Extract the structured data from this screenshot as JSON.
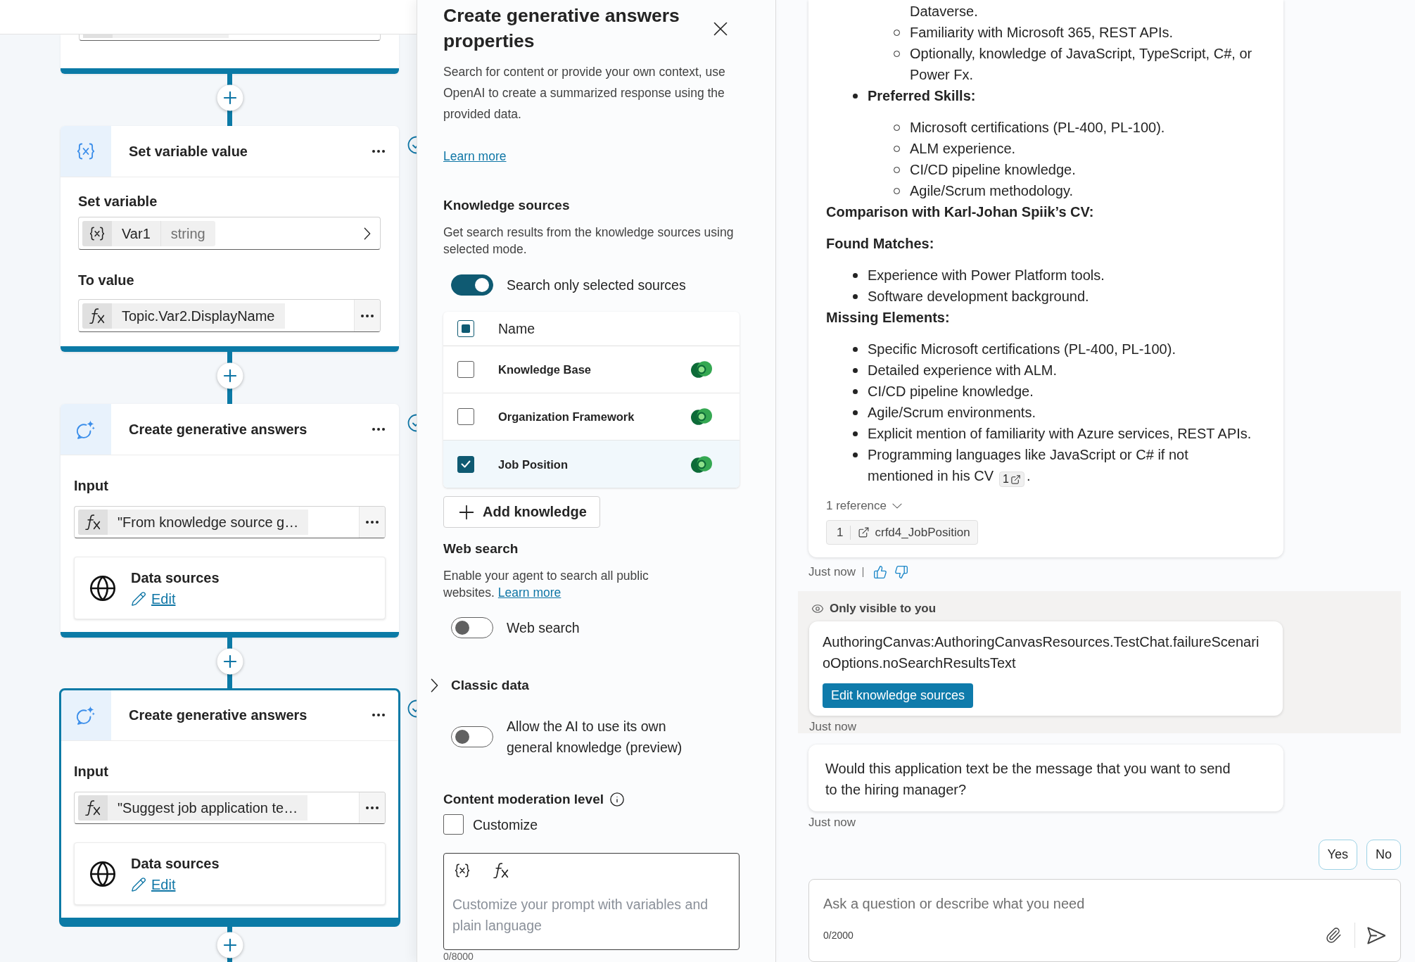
{
  "flow_canvas": {
    "nodes": [
      {
        "kind": "set_variable",
        "title": "Set variable value",
        "selected": false,
        "variable_label": "Set variable",
        "variable": "Var1",
        "variable_type": "string",
        "value_label": "To value",
        "value": "Topic.Var2.DisplayName"
      },
      {
        "kind": "generative_answers",
        "title": "Create generative answers",
        "selected": false,
        "input_label": "Input",
        "input": "\"From knowledge source g…",
        "data_sources_label": "Data sources",
        "edit_link": "Edit"
      },
      {
        "kind": "generative_answers",
        "title": "Create generative answers",
        "selected": true,
        "input_label": "Input",
        "input": "\"Suggest job application te…",
        "data_sources_label": "Data sources",
        "edit_link": "Edit"
      }
    ]
  },
  "properties_panel": {
    "title": "Create generative answers properties",
    "description": "Search for content or provide your own context, use OpenAI to create a summarized response using the provided data.",
    "learn_more": "Learn more",
    "knowledge_sources": {
      "heading": "Knowledge sources",
      "description": "Get search results from the knowledge sources using selected mode.",
      "toggle": {
        "label": "Search only selected sources",
        "on": true
      },
      "select_all": {
        "label": "Name",
        "checked": false,
        "indeterminate": true
      },
      "sources": [
        {
          "name": "Knowledge Base",
          "checked": false
        },
        {
          "name": "Organization Framework",
          "checked": false
        },
        {
          "name": "Job Position",
          "checked": true
        }
      ],
      "add_button": "Add knowledge"
    },
    "web_search": {
      "heading": "Web search",
      "description": "Enable your agent to search all public websites.",
      "learn_more": "Learn more",
      "toggle": {
        "label": "Web search",
        "on": false
      }
    },
    "classic_data": {
      "heading": "Classic data",
      "expanded": false
    },
    "general_knowledge": {
      "label": "Allow the AI to use its own general knowledge (preview)",
      "on": false
    },
    "content_moderation": {
      "heading": "Content moderation level",
      "customize": {
        "label": "Customize",
        "checked": false
      },
      "prompt": {
        "placeholder": "Customize your prompt with variables and plain language",
        "counter": "0/8000"
      }
    }
  },
  "chat": {
    "messages": [
      {
        "kind": "answer",
        "content": [
          {
            "kind": "list",
            "items": [
              {
                "children": [
                  {
                    "kind": "continuation",
                    "text": "Dataverse."
                  },
                  {
                    "kind": "bullet",
                    "text": "Familiarity with Microsoft 365, REST APIs."
                  },
                  {
                    "kind": "bullet",
                    "text": "Optionally, knowledge of JavaScript, TypeScript, C#, or Power Fx."
                  }
                ]
              },
              {
                "text": "Preferred Skills:",
                "bold": true,
                "children": [
                  {
                    "text": "Microsoft certifications (PL-400, PL-100)."
                  },
                  {
                    "text": "ALM experience."
                  },
                  {
                    "text": "CI/CD pipeline knowledge."
                  },
                  {
                    "text": "Agile/Scrum methodology."
                  }
                ]
              }
            ]
          },
          {
            "kind": "heading",
            "text": "Comparison with Karl-Johan Spiik’s CV:"
          },
          {
            "kind": "heading",
            "text": "Found Matches:"
          },
          {
            "kind": "list",
            "items": [
              {
                "text": "Experience with Power Platform tools."
              },
              {
                "text": "Software development background."
              }
            ]
          },
          {
            "kind": "heading",
            "text": "Missing Elements:"
          },
          {
            "kind": "list",
            "items": [
              {
                "text": "Specific Microsoft certifications (PL-400, PL-100)."
              },
              {
                "text": "Detailed experience with ALM."
              },
              {
                "text": "CI/CD pipeline knowledge."
              },
              {
                "text": "Agile/Scrum environments."
              },
              {
                "text": "Explicit mention of familiarity with Azure services, REST APIs."
              },
              {
                "text": "Programming languages like JavaScript or C# if not mentioned in his CV",
                "citation": "1",
                "after_citation": "."
              }
            ]
          }
        ],
        "references_toggle": "1 reference",
        "references": [
          {
            "number": "1",
            "name": "crfd4_JobPosition"
          }
        ],
        "time": "Just now"
      },
      {
        "kind": "private_notice",
        "notice": "Only visible to you",
        "text": "AuthoringCanvas:AuthoringCanvasResources.TestChat.failureScenarioOptions.noSearchResultsText",
        "button": "Edit knowledge sources",
        "time": "Just now"
      },
      {
        "kind": "question",
        "text": "Would this application text be the message that you want to send to the hiring manager?",
        "time": "Just now"
      }
    ],
    "quick_replies": [
      "Yes",
      "No"
    ],
    "composer": {
      "placeholder": "Ask a question or describe what you need",
      "counter": "0/2000"
    }
  }
}
